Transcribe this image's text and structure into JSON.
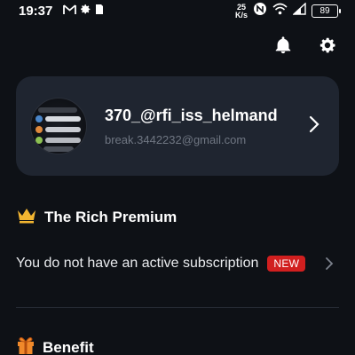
{
  "status_bar": {
    "time": "19:37",
    "icons_left": [
      "gmail-icon",
      "gear-icon",
      "sim-icon"
    ],
    "speed_value": "25",
    "speed_unit": "K/s",
    "icons_right": [
      "nfc-icon",
      "wifi-icon",
      "signal-icon",
      "battery-icon"
    ],
    "battery": "89"
  },
  "top_actions": [
    "bell-icon",
    "settings-icon"
  ],
  "profile": {
    "username": "370_@rfi_iss_helmand",
    "email": "break.3442232@gmail.com"
  },
  "premium": {
    "title": "The Rich Premium",
    "icon": "crown-icon",
    "subscription_text": "You do not have an active subscription",
    "badge": "NEW",
    "accent": "#d11f1f"
  },
  "benefit": {
    "title": "Benefit",
    "icon": "gift-icon"
  },
  "colors": {
    "background": "#0e1116",
    "card": "#1f2530",
    "crown": "#f2b531",
    "gift": "#f0892a"
  }
}
